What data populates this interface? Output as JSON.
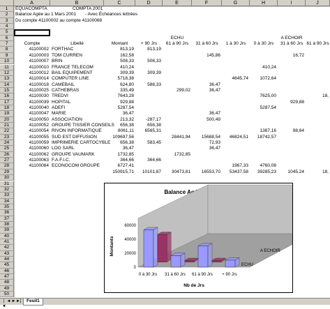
{
  "columns": [
    "A",
    "B",
    "C",
    "D",
    "E",
    "F",
    "G",
    "H",
    "I",
    "J"
  ],
  "row_count": 50,
  "cells": {
    "title": "EQUACOMPTA",
    "company": "COMPTA 2001",
    "subtitle": "Balance Agée au 1 Mars 2001",
    "subtitle2": "- Avec Échéances lettrées",
    "range_text": "Du compte 41100002 au compte 41100068",
    "echu": "ECHU",
    "a_echoir": "A ECHOIR",
    "hdr_compte": "Compte",
    "hdr_libelle": "Libellé",
    "hdr_montant": "Montant",
    "hdr_90plus": "+ 90 Jrs",
    "hdr_61_90": "61 à 90 Jrs",
    "hdr_31_60": "31 à 60 Jrs",
    "hdr_1_30": "1 à 30 Jrs",
    "hdr_0_30": "0 à 30 Jrs",
    "hdr_31_60b": "31 à 60 Jrs",
    "hdr_61_90b": "61 à 90 Jrs"
  },
  "rows": [
    {
      "compte": "41100002",
      "libelle": "FORTHAC",
      "montant": "813,19",
      "d": "813,19",
      "e": "",
      "f": "",
      "g": "",
      "h": "",
      "i": "",
      "j": ""
    },
    {
      "compte": "41100003",
      "libelle": "TOM CURREN",
      "montant": "162,58",
      "d": "",
      "e": "",
      "f": "145,86",
      "g": "",
      "h": "",
      "i": "16,72",
      "j": ""
    },
    {
      "compte": "41100007",
      "libelle": "BRIN",
      "montant": "508,33",
      "d": "508,33",
      "e": "",
      "f": "",
      "g": "",
      "h": "",
      "i": "",
      "j": ""
    },
    {
      "compte": "41100010",
      "libelle": "FRANCE TELECOM",
      "montant": "410,24",
      "d": "",
      "e": "",
      "f": "",
      "g": "",
      "h": "410,24",
      "i": "",
      "j": ""
    },
    {
      "compte": "41100012",
      "libelle": "BAIL EQUIPEMENT",
      "montant": "309,39",
      "d": "309,39",
      "e": "",
      "f": "",
      "g": "",
      "h": "",
      "i": "",
      "j": ""
    },
    {
      "compte": "41100014",
      "libelle": "COMPUTER LINE",
      "montant": "5718,38",
      "d": "",
      "e": "",
      "f": "",
      "g": "4645,74",
      "h": "1072,64",
      "i": "",
      "j": ""
    },
    {
      "compte": "41100018",
      "libelle": "CAMEBAIL",
      "montant": "624,80",
      "d": "588,33",
      "e": "",
      "f": "36,47",
      "g": "",
      "h": "",
      "i": "",
      "j": ""
    },
    {
      "compte": "41100025",
      "libelle": "CATHEBRAS",
      "montant": "335,49",
      "d": "",
      "e": "299,02",
      "f": "36,47",
      "g": "",
      "h": "",
      "i": "",
      "j": ""
    },
    {
      "compte": "41100030",
      "libelle": "TREDVI",
      "montant": "7643,28",
      "d": "",
      "e": "",
      "f": "",
      "g": "",
      "h": "7625,00",
      "i": "",
      "j": "18,"
    },
    {
      "compte": "41100039",
      "libelle": "HOPITAL",
      "montant": "929,88",
      "d": "",
      "e": "",
      "f": "",
      "g": "",
      "h": "",
      "i": "929,88",
      "j": ""
    },
    {
      "compte": "41100040",
      "libelle": "ADEFI",
      "montant": "5287,54",
      "d": "",
      "e": "",
      "f": "",
      "g": "",
      "h": "5287,54",
      "i": "",
      "j": ""
    },
    {
      "compte": "41100047",
      "libelle": "MARIE",
      "montant": "36,47",
      "d": "",
      "e": "",
      "f": "36,47",
      "g": "",
      "h": "",
      "i": "",
      "j": ""
    },
    {
      "compte": "41100050",
      "libelle": "ASSOCIATION",
      "montant": "213,32",
      "d": "-287,17",
      "e": "",
      "f": "500,49",
      "g": "",
      "h": "",
      "i": "",
      "j": ""
    },
    {
      "compte": "41100052",
      "libelle": "GROUPE TISSIER CONSEILS",
      "montant": "656,38",
      "d": "656,38",
      "e": "",
      "f": "",
      "g": "",
      "h": "",
      "i": "",
      "j": ""
    },
    {
      "compte": "41100054",
      "libelle": "RIVON INFORMATIQUE",
      "montant": "8061,11",
      "d": "6565,31",
      "e": "",
      "f": "",
      "g": "",
      "h": "1387,16",
      "i": "98,64",
      "j": ""
    },
    {
      "compte": "41100055",
      "libelle": "SUD EST DIFFUSION",
      "montant": "109697,56",
      "d": "",
      "e": "28441,94",
      "f": "15688,54",
      "g": "46824,51",
      "h": "18742,57",
      "i": "",
      "j": ""
    },
    {
      "compte": "41100059",
      "libelle": "IMPRIMERIE CARTOCYBLE",
      "montant": "656,38",
      "d": "583,45",
      "e": "",
      "f": "72,93",
      "g": "",
      "h": "",
      "i": "",
      "j": ""
    },
    {
      "compte": "41100060",
      "libelle": "LOG SARL",
      "montant": "36,47",
      "d": "",
      "e": "",
      "f": "36,47",
      "g": "",
      "h": "",
      "i": "",
      "j": ""
    },
    {
      "compte": "41100062",
      "libelle": "GROUPE VAUMARK",
      "montant": "1732,85",
      "d": "",
      "e": "1732,85",
      "f": "",
      "g": "",
      "h": "",
      "i": "",
      "j": ""
    },
    {
      "compte": "41100063",
      "libelle": "F.A.F.I.C.",
      "montant": "364,66",
      "d": "364,66",
      "e": "",
      "f": "",
      "g": "",
      "h": "",
      "i": "",
      "j": ""
    },
    {
      "compte": "41100064",
      "libelle": "ECONOCOM GROUPE",
      "montant": "6727,41",
      "d": "",
      "e": "",
      "f": "",
      "g": "1967,33",
      "h": "4760,08",
      "i": "",
      "j": ""
    }
  ],
  "totals": {
    "montant": "150915,71",
    "d": "10101,87",
    "e": "30473,81",
    "f": "16553,70",
    "g": "53437,58",
    "h": "39285,23",
    "i": "1045,24",
    "j": "18,"
  },
  "chart_data": {
    "type": "bar",
    "title": "Balance Agée au 01/03/01",
    "xlabel": "Nb de Jrs",
    "ylabel": "Montants",
    "categories": [
      "0 à 30 Jrs",
      "31 à 60 Jrs",
      "61 à 90 Jrs",
      "+ 90 Jrs"
    ],
    "yticks": [
      "0",
      "20000",
      "40000",
      "60000"
    ],
    "ylim": [
      0,
      60000
    ],
    "series": [
      {
        "name": "ECHU",
        "color": "#9999ff",
        "values": [
          53437.58,
          16553.7,
          30473.81,
          10101.87
        ]
      },
      {
        "name": "A ECHOIR",
        "color": "#993366",
        "values": [
          39285.23,
          1045.24,
          18.0,
          0
        ]
      }
    ]
  },
  "sheet_tab": "Feuil1",
  "tab_nav": [
    "|◄",
    "◄",
    "►",
    "►|"
  ]
}
